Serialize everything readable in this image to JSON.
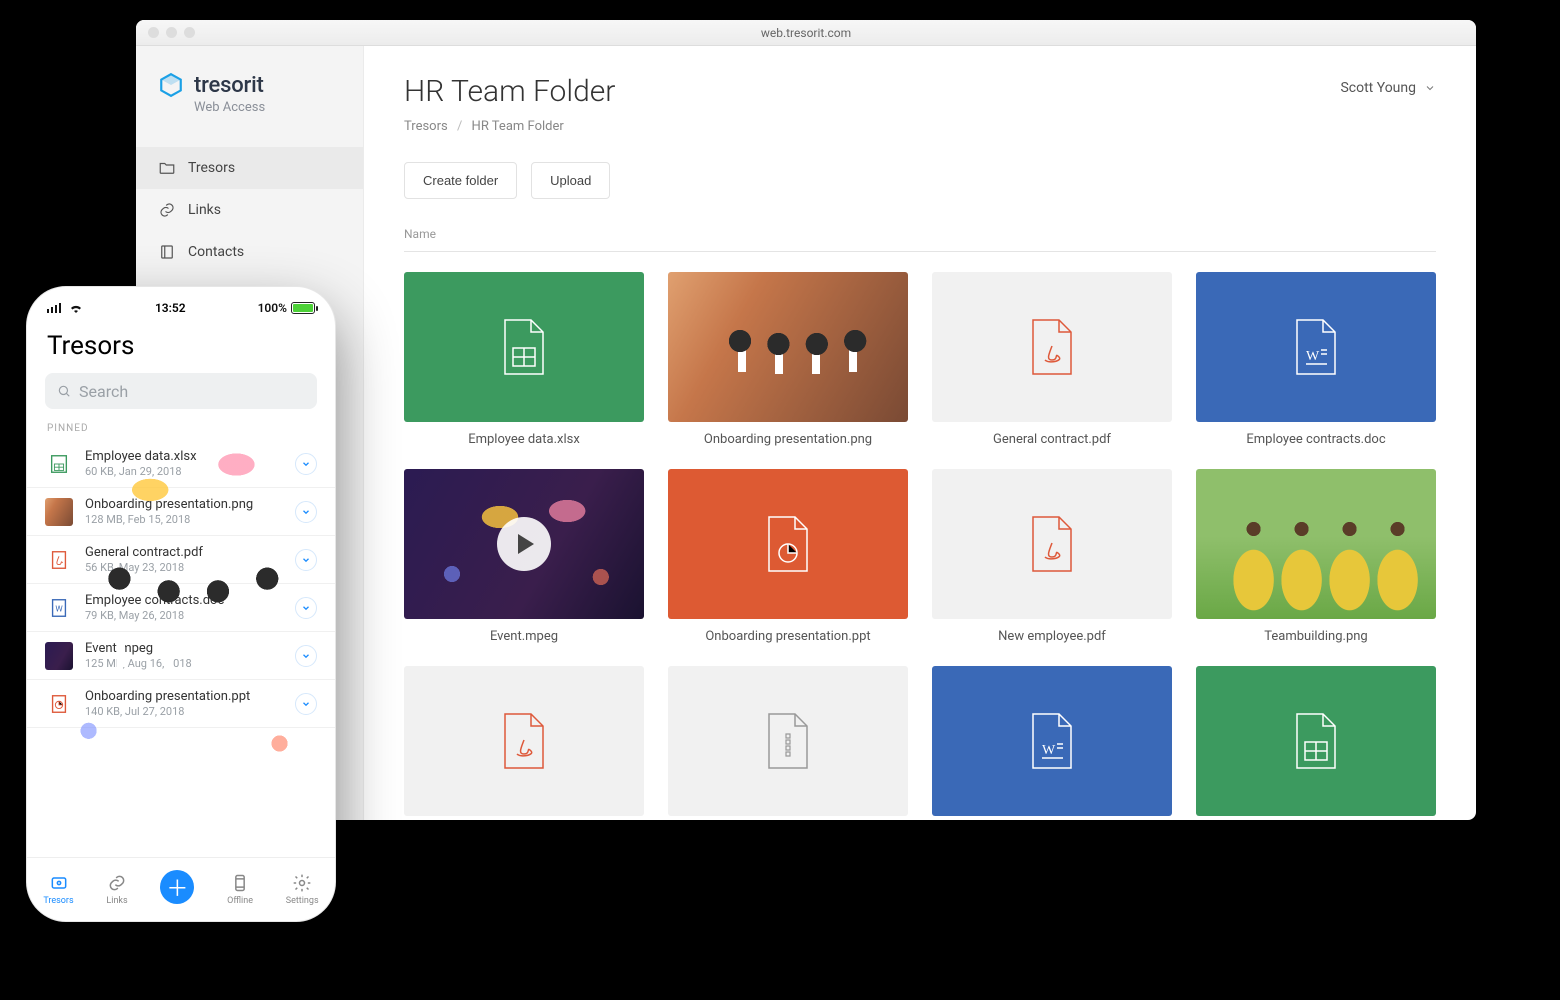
{
  "browser": {
    "url": "web.tresorit.com",
    "brand": "tresorit",
    "brand_sub": "Web Access",
    "nav": [
      {
        "label": "Tresors",
        "icon": "folder-icon",
        "active": true
      },
      {
        "label": "Links",
        "icon": "link-icon",
        "active": false
      },
      {
        "label": "Contacts",
        "icon": "contact-icon",
        "active": false
      }
    ],
    "title": "HR Team Folder",
    "breadcrumbs": [
      "Tresors",
      "HR Team Folder"
    ],
    "user": "Scott Young",
    "actions": {
      "create_folder": "Create folder",
      "upload": "Upload"
    },
    "column_header": "Name",
    "tiles": [
      {
        "label": "Employee data.xlsx",
        "kind": "xlsx",
        "skin": "green"
      },
      {
        "label": "Onboarding presentation.png",
        "kind": "photo",
        "skin": "meeting"
      },
      {
        "label": "General contract.pdf",
        "kind": "pdf",
        "skin": "grey"
      },
      {
        "label": "Employee contracts.doc",
        "kind": "doc",
        "skin": "blue"
      },
      {
        "label": "Event.mpeg",
        "kind": "video",
        "skin": "event"
      },
      {
        "label": "Onboarding presentation.ppt",
        "kind": "ppt",
        "skin": "orange"
      },
      {
        "label": "New employee.pdf",
        "kind": "pdf",
        "skin": "grey"
      },
      {
        "label": "Teambuilding.png",
        "kind": "photo",
        "skin": "team"
      },
      {
        "label": "",
        "kind": "pdf",
        "skin": "grey"
      },
      {
        "label": "",
        "kind": "zip",
        "skin": "grey"
      },
      {
        "label": "",
        "kind": "doc",
        "skin": "blue"
      },
      {
        "label": "",
        "kind": "xlsx",
        "skin": "green"
      }
    ]
  },
  "phone": {
    "time": "13:52",
    "battery": "100%",
    "title": "Tresors",
    "search_placeholder": "Search",
    "section": "PINNED",
    "items": [
      {
        "name": "Employee data.xlsx",
        "meta": "60 KB, Jan 29, 2018",
        "kind": "xlsx"
      },
      {
        "name": "Onboarding presentation.png",
        "meta": "128 MB, Feb 15, 2018",
        "kind": "photo-meeting"
      },
      {
        "name": "General contract.pdf",
        "meta": "56 KB, May 23, 2018",
        "kind": "pdf"
      },
      {
        "name": "Employee contracts.doc",
        "meta": "79 KB, May 26, 2018",
        "kind": "doc"
      },
      {
        "name": "Event.mpeg",
        "meta": "125 MB, Aug 16, 2018",
        "kind": "photo-event"
      },
      {
        "name": "Onboarding presentation.ppt",
        "meta": "140 KB, Jul 27, 2018",
        "kind": "ppt"
      }
    ],
    "tabs": [
      {
        "label": "Tresors",
        "active": true
      },
      {
        "label": "Links",
        "active": false
      },
      {
        "label": "",
        "fab": true
      },
      {
        "label": "Offline",
        "active": false
      },
      {
        "label": "Settings",
        "active": false
      }
    ]
  }
}
